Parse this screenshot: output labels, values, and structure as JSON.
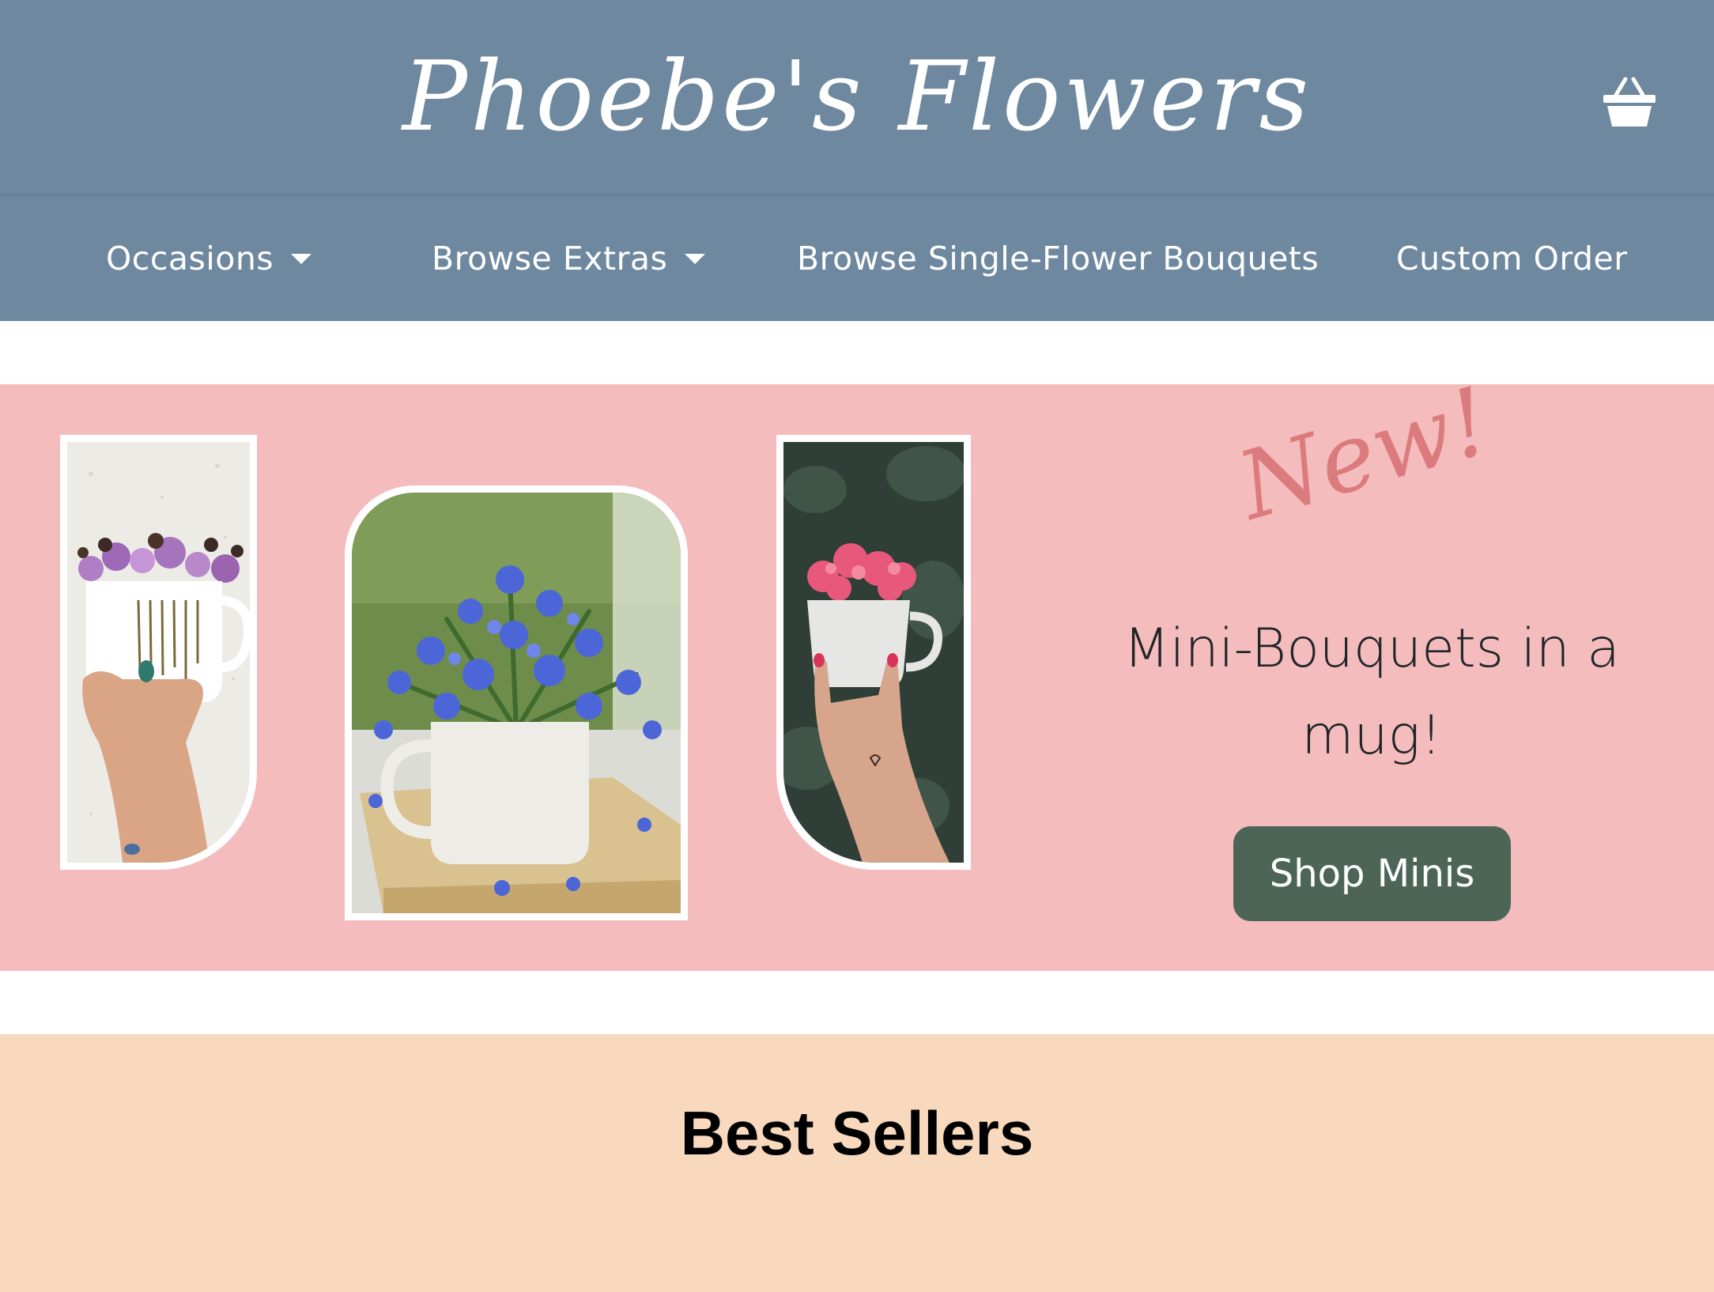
{
  "header": {
    "brand": "Phoebe's Flowers",
    "cart_icon": "basket-icon"
  },
  "nav": {
    "items": [
      {
        "label": "Occasions",
        "has_dropdown": true
      },
      {
        "label": "Browse Extras",
        "has_dropdown": true
      },
      {
        "label": "Browse Single-Flower Bouquets",
        "has_dropdown": false
      },
      {
        "label": "Custom Order",
        "has_dropdown": false
      }
    ]
  },
  "hero": {
    "tag": "New!",
    "heading": "Mini-Bouquets in a mug!",
    "button_label": "Shop Minis",
    "photos": [
      "purple-flowers-mug-photo",
      "blue-flowers-mug-photo",
      "pink-flowers-cup-photo"
    ]
  },
  "best_sellers": {
    "title": "Best Sellers"
  },
  "colors": {
    "header_bg": "#6e889f",
    "hero_bg": "#f4bcbc",
    "accent_pink": "#db7b7e",
    "button_bg": "#4c6557",
    "best_sellers_bg": "#f8d9bd"
  }
}
